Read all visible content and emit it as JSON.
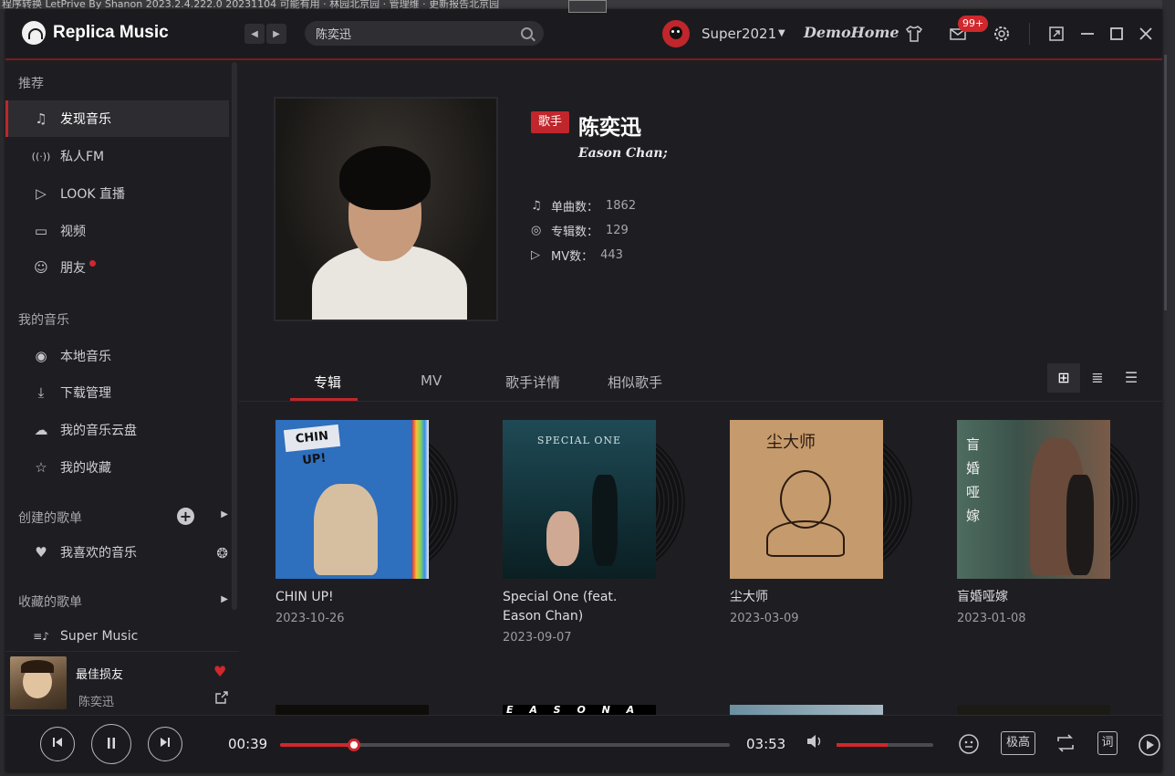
{
  "background": {
    "top_strip_text": "程序转换 LetPrive By Shanon 2023.2.4.222.0 20231104 可能有用  · 林园北京园   · 管理维 · 更新报告北京园"
  },
  "app": {
    "name": "Replica Music",
    "accent": "#c0262b"
  },
  "titlebar": {
    "back_icon": "◀",
    "forward_icon": "▶",
    "search_value": "陈奕迅",
    "search_placeholder": "搜索",
    "username": "Super2021",
    "caret": "▼",
    "brand_text": "DemoHome",
    "mail_badge": "99+"
  },
  "sidebar": {
    "section_recommend": "推荐",
    "recommend_items": [
      {
        "label": "发现音乐",
        "icon": "♫"
      },
      {
        "label": "私人FM",
        "icon": "((·))"
      },
      {
        "label": "LOOK 直播",
        "icon": "▷"
      },
      {
        "label": "视频",
        "icon": "▭"
      },
      {
        "label": "朋友",
        "icon": "☺"
      }
    ],
    "section_my_music": "我的音乐",
    "my_music_items": [
      {
        "label": "本地音乐",
        "icon": "◉"
      },
      {
        "label": "下载管理",
        "icon": "⤓"
      },
      {
        "label": "我的音乐云盘",
        "icon": "☁"
      },
      {
        "label": "我的收藏",
        "icon": "☆"
      }
    ],
    "section_created": "创建的歌单",
    "created_items": [
      {
        "label": "我喜欢的音乐",
        "icon": "♥"
      }
    ],
    "section_collected": "收藏的歌单",
    "collected_items": [
      {
        "label": "Super Music",
        "icon": "≡♪"
      }
    ],
    "add_symbol": "+",
    "expand_symbol": "▶"
  },
  "now_playing": {
    "title": "最佳损友",
    "artist": "陈奕迅"
  },
  "artist": {
    "tag": "歌手",
    "name": "陈奕迅",
    "alias": "Eason Chan;",
    "stats": [
      {
        "label": "单曲数：",
        "value": "1862",
        "icon": "♫"
      },
      {
        "label": "专辑数：",
        "value": "129",
        "icon": "◎"
      },
      {
        "label": "MV数：",
        "value": "443",
        "icon": "▷"
      }
    ]
  },
  "tabs": [
    {
      "label": "专辑",
      "active": true
    },
    {
      "label": "MV",
      "active": false
    },
    {
      "label": "歌手详情",
      "active": false
    },
    {
      "label": "相似歌手",
      "active": false
    }
  ],
  "view_modes": [
    {
      "name": "grid",
      "icon": "⊞",
      "selected": true
    },
    {
      "name": "list",
      "icon": "≣",
      "selected": false
    },
    {
      "name": "detail",
      "icon": "☰",
      "selected": false
    }
  ],
  "albums": [
    {
      "title": "CHIN UP!",
      "date": "2023-10-26",
      "cover_text": "CHIN UP!"
    },
    {
      "title": "Special One (feat. Eason Chan)",
      "date": "2023-09-07",
      "cover_text": "SPECIAL ONE"
    },
    {
      "title": "尘大师",
      "date": "2023-03-09",
      "cover_text": "尘大师"
    },
    {
      "title": "盲婚哑嫁",
      "date": "2023-01-08",
      "cover_text": "盲婚哑嫁"
    }
  ],
  "second_row_peek": {
    "cover2_text": "E A S O N A I R"
  },
  "player": {
    "elapsed": "00:39",
    "duration": "03:53",
    "progress_fraction": 0.165,
    "volume_fraction": 0.53,
    "quality_label": "极高",
    "lyrics_label": "词"
  }
}
